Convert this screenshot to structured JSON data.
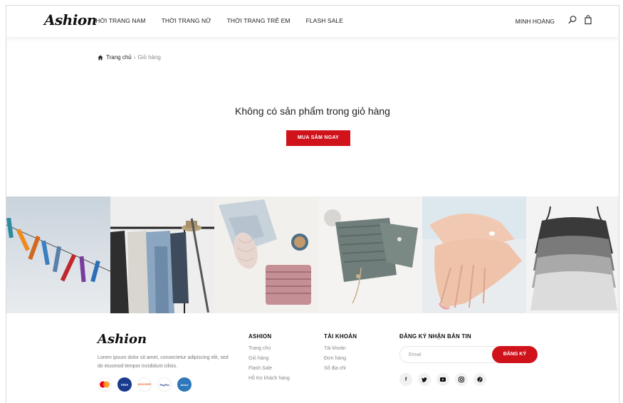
{
  "header": {
    "logo": "Ashion",
    "nav": [
      "THỜI TRANG NAM",
      "THỜI TRANG NỮ",
      "THỜI TRANG TRẺ EM",
      "FLASH SALE"
    ],
    "user_name": "MINH HOÀNG",
    "icons": [
      "search-icon",
      "shopping-bag-icon"
    ]
  },
  "breadcrumb": {
    "home": "Trang chủ",
    "separator": "›",
    "current": "Giỏ hàng"
  },
  "cart": {
    "empty_message": "Không có sản phẩm trong giỏ hàng",
    "shop_button": "MUA SẮM NGAY"
  },
  "gallery": {
    "images": [
      "clothespins",
      "clothing-rack",
      "knitting-supplies",
      "knit-baby-clothes",
      "hands-cream",
      "camisoles"
    ]
  },
  "footer": {
    "logo": "Ashion",
    "description": "Lorem ipsum dolor sit amet, consectetur adipiscing elit, sed do eiusmod tempor incididunt cilisis.",
    "payments": [
      "MasterCard",
      "VISA",
      "DISCOVER",
      "PayPal",
      "Amex"
    ],
    "col1": {
      "title": "ASHION",
      "links": [
        "Trang chủ",
        "Giỏ hàng",
        "Flash Sale",
        "Hỗ trợ khách hàng"
      ]
    },
    "col2": {
      "title": "TÀI KHOẢN",
      "links": [
        "Tài khoản",
        "Đơn hàng",
        "Sổ địa chỉ"
      ]
    },
    "newsletter": {
      "title": "ĐĂNG KÝ NHẬN BẢN TIN",
      "placeholder": "Email",
      "button": "ĐĂNG KÝ"
    },
    "socials": [
      "f",
      "t",
      "yt",
      "ig",
      "p"
    ]
  },
  "colors": {
    "accent": "#d0121b",
    "text": "#222222",
    "muted": "#888888"
  }
}
